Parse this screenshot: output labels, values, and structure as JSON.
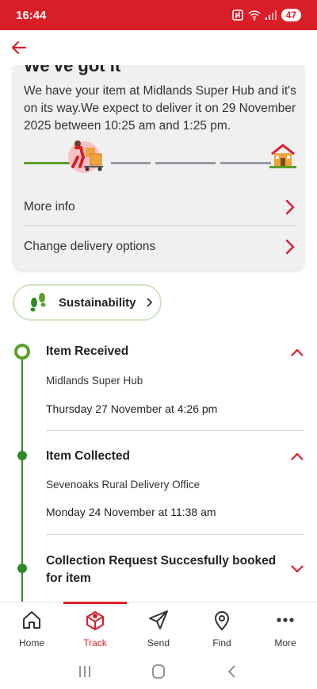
{
  "status_bar": {
    "time": "16:44",
    "battery": "47"
  },
  "header": {
    "back_icon": "arrow-left-icon"
  },
  "delivery_card": {
    "heading": "We've got it",
    "message": "We have your item at Midlands Super Hub and it's on its way.We expect to deliver it on 29 November 2025 between 10:25 am and 1:25 pm.",
    "progress_fraction": 0.2,
    "links": [
      {
        "label": "More info"
      },
      {
        "label": "Change delivery options"
      }
    ]
  },
  "sustainability": {
    "label": "Sustainability"
  },
  "timeline": [
    {
      "title": "Item Received",
      "location": "Midlands Super Hub",
      "datetime": "Thursday 27 November at 4:26 pm",
      "expanded": true
    },
    {
      "title": "Item Collected",
      "location": "Sevenoaks Rural Delivery Office",
      "datetime": "Monday 24 November at 11:38 am",
      "expanded": true
    },
    {
      "title": "Collection Request Succesfully booked for item",
      "expanded": false
    }
  ],
  "bottom_nav": [
    {
      "label": "Home",
      "icon": "home-icon"
    },
    {
      "label": "Track",
      "icon": "parcel-icon",
      "active": true
    },
    {
      "label": "Send",
      "icon": "send-icon"
    },
    {
      "label": "Find",
      "icon": "location-pin-icon"
    },
    {
      "label": "More",
      "icon": "more-dots-icon"
    }
  ],
  "colors": {
    "brand_red": "#da1e28",
    "green": "#2e8a27",
    "light_green": "#5aa02c"
  }
}
